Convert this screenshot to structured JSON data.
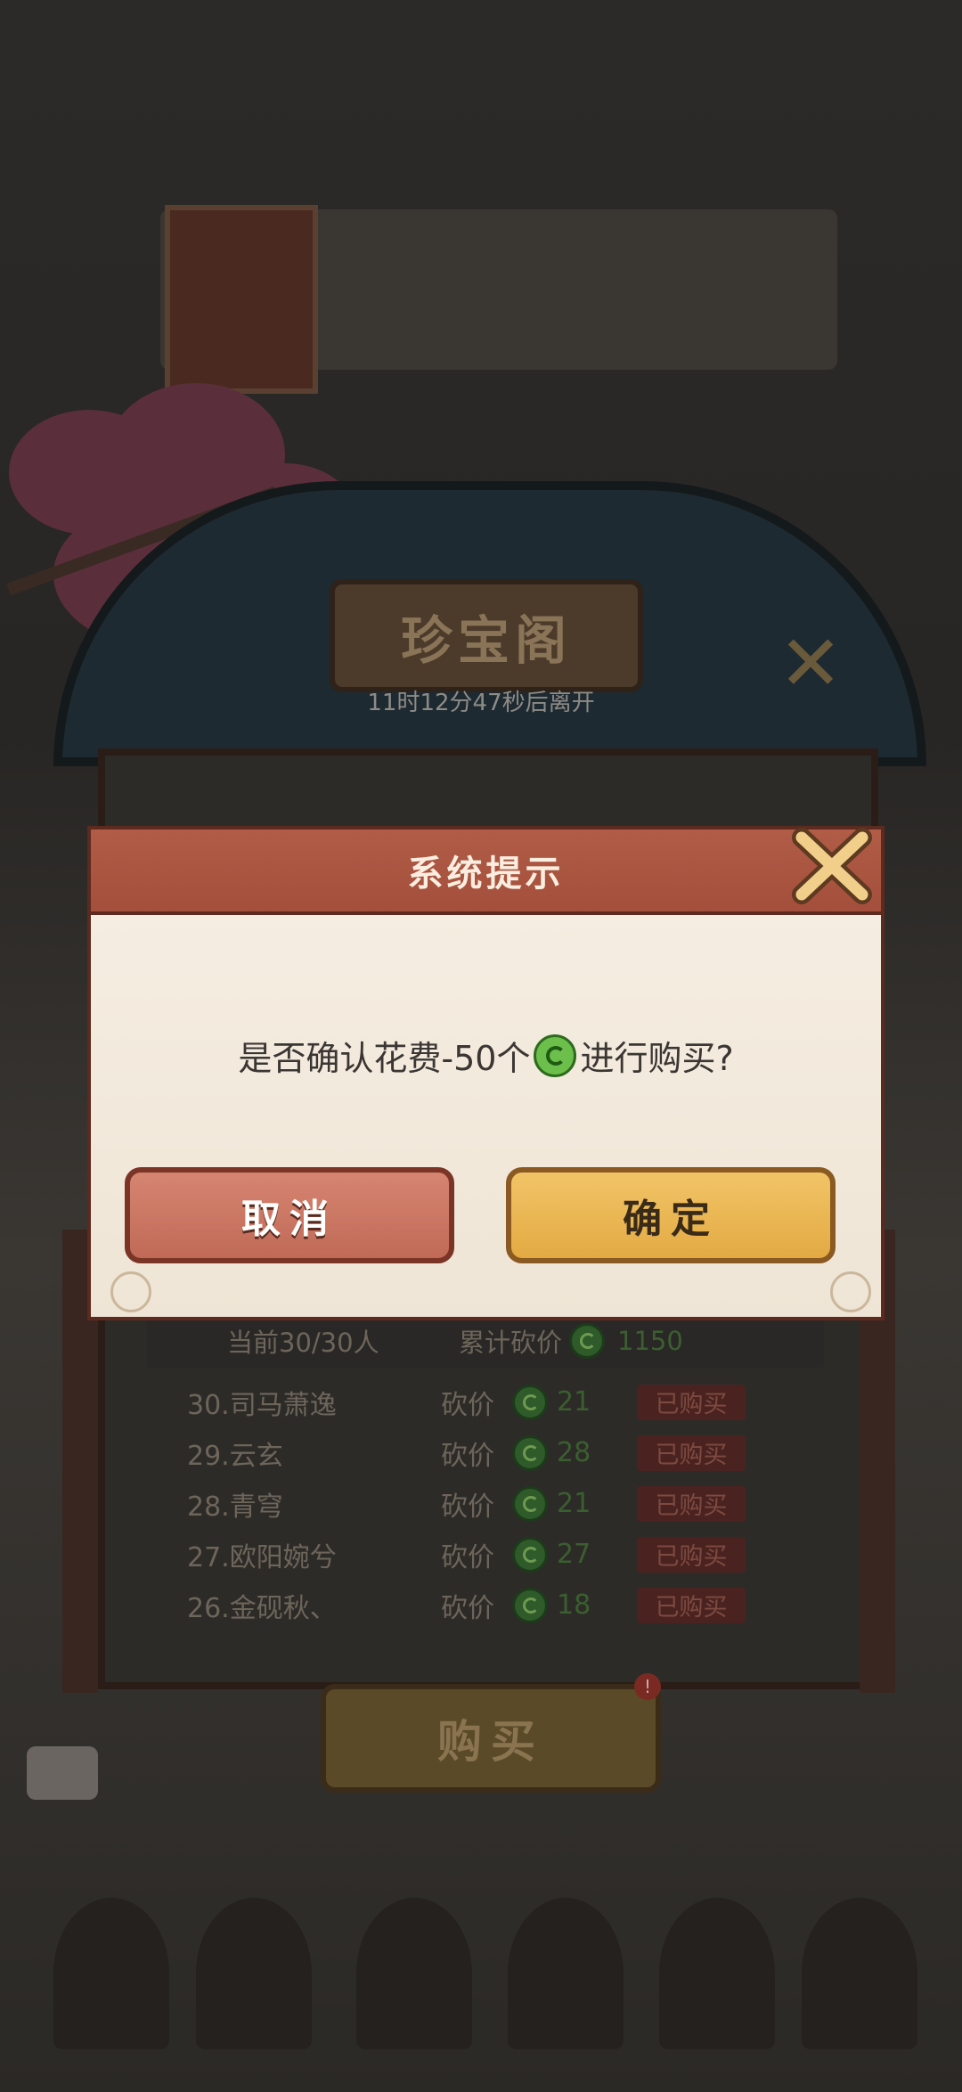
{
  "scene": {
    "shop_title": "珍宝阁",
    "timer_text": "11时12分47秒后离开",
    "stats": {
      "participants": "当前30/30人",
      "total_label": "累计砍价",
      "total_value": "1150"
    },
    "rows": [
      {
        "name": "30.司马萧逸",
        "action": "砍价",
        "amount": "21",
        "status": "已购买"
      },
      {
        "name": "29.云玄",
        "action": "砍价",
        "amount": "28",
        "status": "已购买"
      },
      {
        "name": "28.青穹",
        "action": "砍价",
        "amount": "21",
        "status": "已购买"
      },
      {
        "name": "27.欧阳婉兮",
        "action": "砍价",
        "amount": "27",
        "status": "已购买"
      },
      {
        "name": "26.金砚秋、",
        "action": "砍价",
        "amount": "18",
        "status": "已购买"
      }
    ],
    "buy_label": "购买",
    "buy_badge": "!"
  },
  "dialog": {
    "title": "系统提示",
    "message_before": "是否确认花费-50个",
    "message_after": "进行购买?",
    "cancel_label": "取消",
    "confirm_label": "确定"
  },
  "colors": {
    "header": "#b05c47",
    "cancel": "#d07a66",
    "confirm": "#f0bd5c",
    "coin": "#6cbf4b"
  },
  "icons": [
    "close-icon",
    "jade-coin-icon",
    "chat-icon"
  ]
}
